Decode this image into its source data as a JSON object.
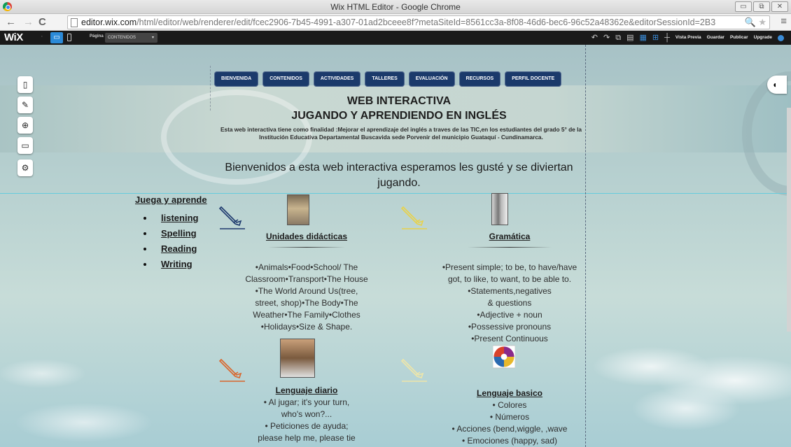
{
  "browser": {
    "window_title": "Wix HTML Editor - Google Chrome",
    "url_domain": "editor.wix.com",
    "url_path": "/html/editor/web/renderer/edit/fcec2906-7b45-4991-a307-01ad2bceee8f?metaSiteId=8561cc3a-8f08-46d6-bec6-96c52a48362e&editorSessionId=2B3"
  },
  "wix_topbar": {
    "logo": "WiX",
    "page_label": "Página",
    "page_selected": "CONTENIDOS",
    "preview": "Vista Previa",
    "save": "Guardar",
    "publish": "Publicar",
    "upgrade": "Upgrade"
  },
  "site": {
    "nav": [
      "BIENVENIDA",
      "CONTENIDOS",
      "ACTIVIDADES",
      "TALLERES",
      "EVALUACIÓN",
      "RECURSOS",
      "PERFIL DOCENTE"
    ],
    "title_line1": "WEB INTERACTIVA",
    "title_line2": "JUGANDO Y APRENDIENDO EN INGLÉS",
    "description": "Esta web interactiva tiene como finalidad :Mejorar el aprendizaje del inglés a traves de las TIC,en los estudiantes del grado 5° de la Institución Educativa Departamental Buscavida sede Porvenir del municipio Guataquí - Cundinamarca.",
    "welcome": "Bienvenidos a esta web interactiva esperamos les gusté y se diviertan jugando.",
    "sidebar": {
      "heading": "Juega y aprende",
      "items": [
        "listening",
        "Spelling",
        "Reading",
        "Writing"
      ]
    },
    "cards": [
      {
        "title": "Unidades didácticas",
        "body": "•Animals•Food•School/ The\nClassroom•Transport•The House\n•The World Around Us(tree,\nstreet, shop)•The Body•The\nWeather•The Family•Clothes\n•Holidays•Size & Shape."
      },
      {
        "title": "Gramática",
        "body": "•Present simple; to be, to have/have\ngot, to like, to want, to be able to.\n•Statements,negatives\n& questions\n•Adjective + noun\n•Possessive pronouns\n•Present Continuous"
      },
      {
        "title": "Lenguaje diario",
        "body": "• Al jugar; it's your turn,\nwho's won?...\n• Peticiones de ayuda;\nplease help me, please tie"
      },
      {
        "title": "Lenguaje basico",
        "body": "• Colores\n• Números\n• Acciones (bend,wiggle, ,wave\n• Emociones (happy, sad)"
      }
    ]
  },
  "icons": {
    "pencil_colors": [
      "#1e3a6e",
      "#e8d24a",
      "#d9662c",
      "#efe6a8"
    ]
  }
}
